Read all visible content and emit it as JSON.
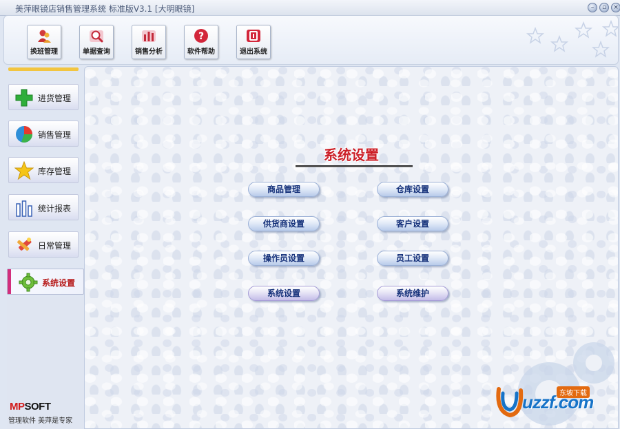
{
  "window": {
    "title": "美萍眼镜店销售管理系统 标准版V3.1 [大明眼镜]",
    "controls": [
      "minimize",
      "restore",
      "close"
    ]
  },
  "toolbar": {
    "buttons": [
      {
        "label": "换班管理",
        "icon": "user-swap-icon"
      },
      {
        "label": "单据查询",
        "icon": "magnifier-icon"
      },
      {
        "label": "销售分析",
        "icon": "bar-chart-icon"
      },
      {
        "label": "软件帮助",
        "icon": "help-icon"
      },
      {
        "label": "退出系统",
        "icon": "exit-icon"
      }
    ]
  },
  "sidebar": {
    "items": [
      {
        "label": "进货管理",
        "icon": "green-plus-icon"
      },
      {
        "label": "销售管理",
        "icon": "pie-chart-icon"
      },
      {
        "label": "库存管理",
        "icon": "star-icon"
      },
      {
        "label": "统计报表",
        "icon": "bars-icon"
      },
      {
        "label": "日常管理",
        "icon": "tools-icon"
      },
      {
        "label": "系统设置",
        "icon": "gear-icon",
        "active": true
      }
    ],
    "brand": {
      "mp": "MP",
      "soft": "SOFT"
    },
    "tagline": "管理软件 美萍是专家"
  },
  "main": {
    "title": "系统设置",
    "buttons": [
      {
        "label": "商品管理"
      },
      {
        "label": "仓库设置"
      },
      {
        "label": "供货商设置"
      },
      {
        "label": "客户设置"
      },
      {
        "label": "操作员设置"
      },
      {
        "label": "员工设置"
      },
      {
        "label": "系统设置"
      },
      {
        "label": "系统维护"
      }
    ]
  },
  "watermark": {
    "text": "uzzf.com",
    "tag": "东坡下载"
  },
  "colors": {
    "title_red": "#cc1f27",
    "active_accent": "#d22e7c",
    "pill_text": "#15317a",
    "sidebar_top_line": "#f2c540"
  }
}
